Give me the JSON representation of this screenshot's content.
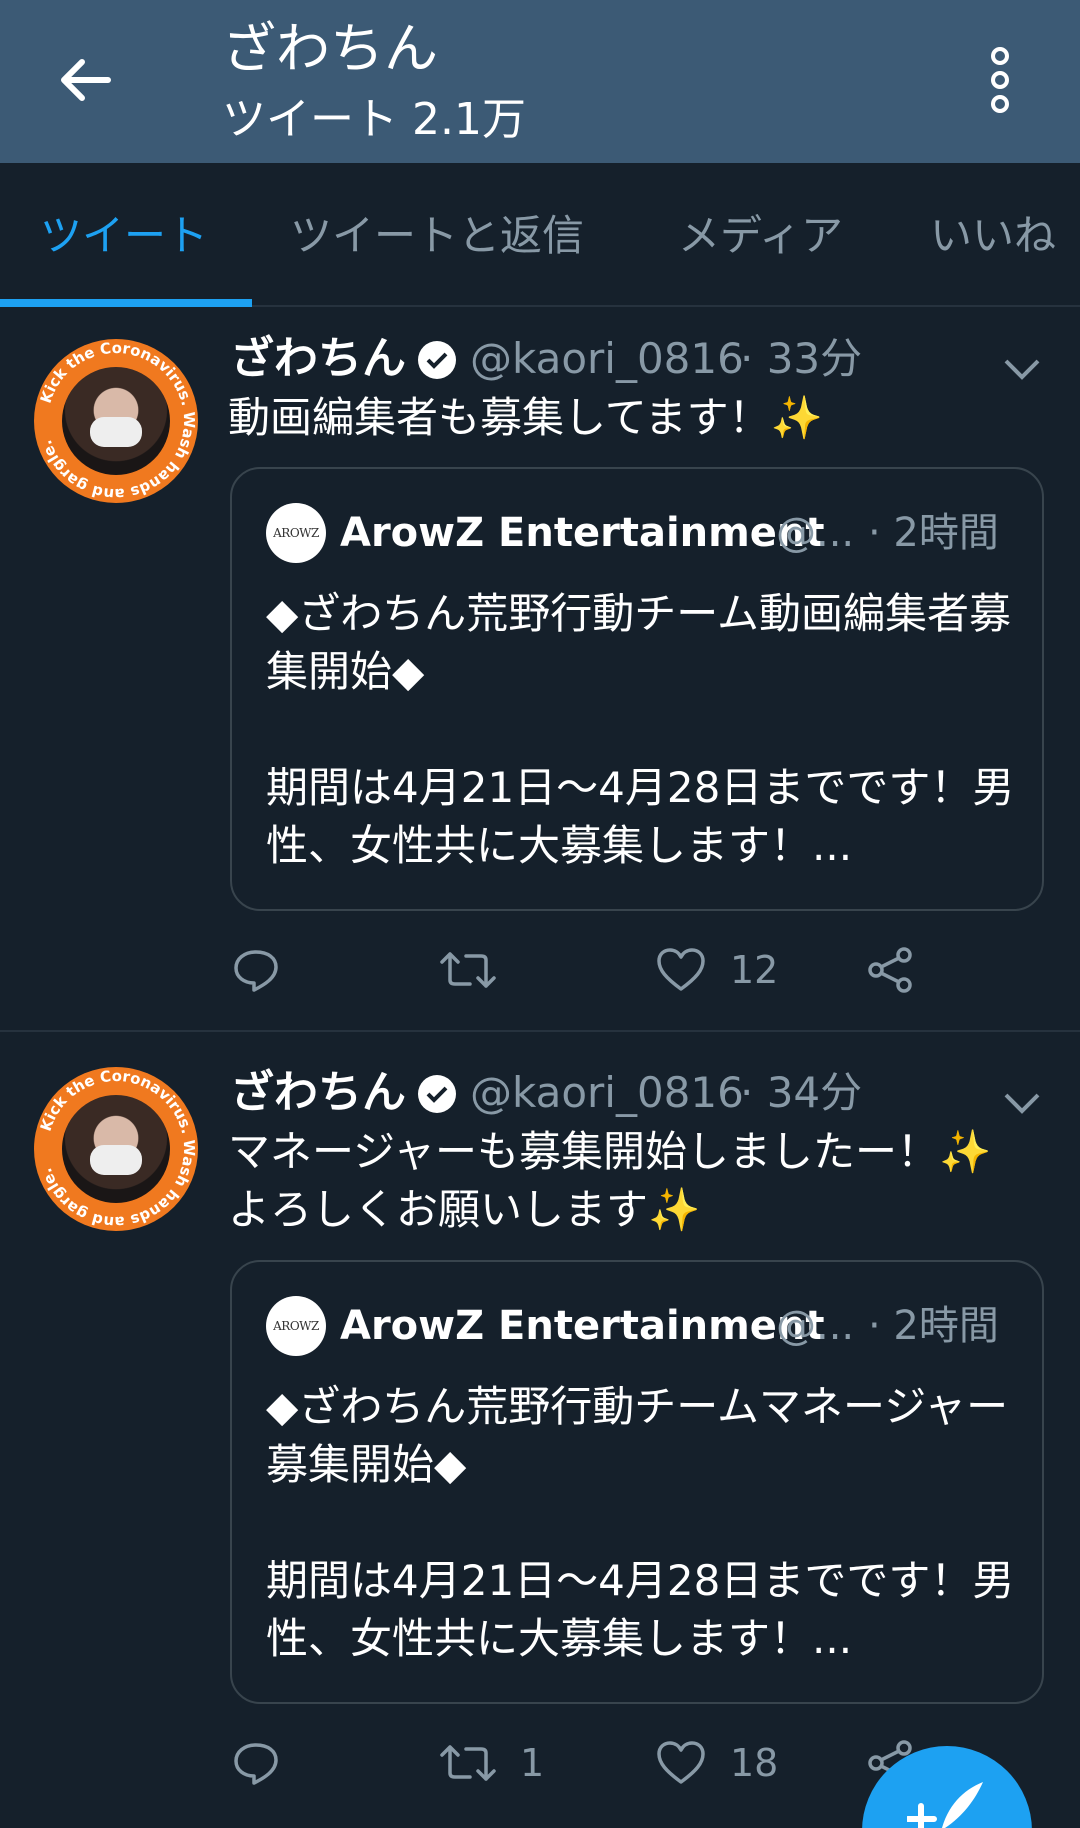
{
  "header": {
    "title": "ざわちん",
    "subtitle": "ツイート 2.1万"
  },
  "tabs": [
    {
      "label": "ツイート",
      "active": true
    },
    {
      "label": "ツイートと返信",
      "active": false
    },
    {
      "label": "メディア",
      "active": false
    },
    {
      "label": "いいね",
      "active": false
    }
  ],
  "tweets": [
    {
      "name": "ざわちん",
      "handle": "@kaori_0816",
      "time": "· 33分",
      "text": "動画編集者も募集してます！✨",
      "quote": {
        "avatar_text": "AROWZ",
        "name": "ArowZ Entertainment",
        "handle": "@...",
        "time": "· 2時間",
        "body": "◆ざわちん荒野行動チーム動画編集者募集開始◆\n\n期間は4月21日〜4月28日までです！男性、女性共に大募集します！..."
      },
      "actions": {
        "reply": "",
        "retweet": "",
        "like": "12"
      }
    },
    {
      "name": "ざわちん",
      "handle": "@kaori_0816",
      "time": "· 34分",
      "text": "マネージャーも募集開始しましたー！✨よろしくお願いします✨",
      "quote": {
        "avatar_text": "AROWZ",
        "name": "ArowZ Entertainment",
        "handle": "@...",
        "time": "· 2時間",
        "body": "◆ざわちん荒野行動チームマネージャー募集開始◆\n\n期間は4月21日〜4月28日までです！男性、女性共に大募集します！..."
      },
      "actions": {
        "reply": "",
        "retweet": "1",
        "like": "18"
      }
    }
  ],
  "avatar_ring_text": "Kick the Coronavirus. Wash hands and gargle.",
  "colors": {
    "background": "#15202b",
    "header": "#3c5a75",
    "accent": "#1da1f2",
    "muted": "#8899a6",
    "border": "#38444d",
    "avatar_ring": "#f0791f"
  },
  "icons": {
    "back": "arrow-left-icon",
    "more": "more-vertical-icon",
    "verified": "verified-badge-icon",
    "caret": "chevron-down-icon",
    "reply": "reply-icon",
    "retweet": "retweet-icon",
    "like": "heart-icon",
    "share": "share-icon",
    "compose": "compose-icon"
  }
}
